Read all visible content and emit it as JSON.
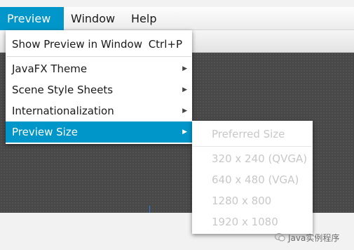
{
  "menubar": {
    "items": [
      {
        "label": "Preview"
      },
      {
        "label": "Window"
      },
      {
        "label": "Help"
      }
    ]
  },
  "preview_menu": {
    "show_in_window": {
      "label": "Show Preview in Window",
      "shortcut": "Ctrl+P"
    },
    "javafx_theme": "JavaFX Theme",
    "scene_style_sheets": "Scene Style Sheets",
    "internationalization": "Internationalization",
    "preview_size": "Preview Size"
  },
  "preview_size_submenu": {
    "items": [
      "Preferred Size",
      "320 x 240 (QVGA)",
      "640 x 480 (VGA)",
      "1280 x 800",
      "1920 x 1080"
    ]
  },
  "colors": {
    "accent": "#0096c9",
    "canvas": "#484848",
    "disabled_text": "#c8c8c8"
  },
  "watermark": {
    "text": "Java实例程序",
    "icon": "wechat-icon"
  }
}
